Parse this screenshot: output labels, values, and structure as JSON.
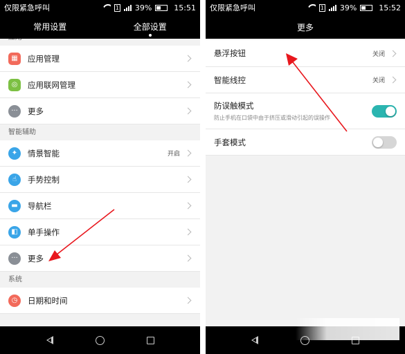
{
  "left": {
    "status": {
      "carrier": "仅限紧急呼叫",
      "sim": "1",
      "battery": "39%",
      "time": "15:51"
    },
    "tabs": [
      {
        "label": "常用设置"
      },
      {
        "label": "全部设置"
      }
    ],
    "sections": [
      {
        "header": "应用",
        "items": [
          {
            "label": "应用管理",
            "icon": "grid-icon",
            "color": "#f26a5b"
          },
          {
            "label": "应用联网管理",
            "icon": "network-icon",
            "color": "#7cc043"
          },
          {
            "label": "更多",
            "icon": "more-dots-icon",
            "color": "#8a8f96"
          }
        ]
      },
      {
        "header": "智能辅助",
        "items": [
          {
            "label": "情景智能",
            "value": "开启",
            "icon": "bulb-icon",
            "color": "#3aa5e8"
          },
          {
            "label": "手势控制",
            "icon": "hand-icon",
            "color": "#3aa5e8"
          },
          {
            "label": "导航栏",
            "icon": "nav-bar-icon",
            "color": "#3aa5e8"
          },
          {
            "label": "单手操作",
            "icon": "one-hand-icon",
            "color": "#3aa5e8"
          },
          {
            "label": "更多",
            "icon": "more-dots-icon",
            "color": "#8a8f96"
          }
        ]
      },
      {
        "header": "系统",
        "items": [
          {
            "label": "日期和时间",
            "icon": "clock-icon",
            "color": "#f26a5b"
          }
        ]
      }
    ]
  },
  "right": {
    "status": {
      "carrier": "仅限紧急呼叫",
      "sim": "1",
      "battery": "39%",
      "time": "15:52"
    },
    "title": "更多",
    "items": [
      {
        "label": "悬浮按钮",
        "value": "关闭"
      },
      {
        "label": "智能线控",
        "value": "关闭"
      },
      {
        "label": "防误触模式",
        "sub": "防止手机在口袋中由于挤压或滑动引起的误操作",
        "toggle": "on"
      },
      {
        "label": "手套模式",
        "toggle": "off"
      }
    ]
  },
  "colors": {
    "accent": "#2bb5b0",
    "arrow": "#e8171d"
  }
}
